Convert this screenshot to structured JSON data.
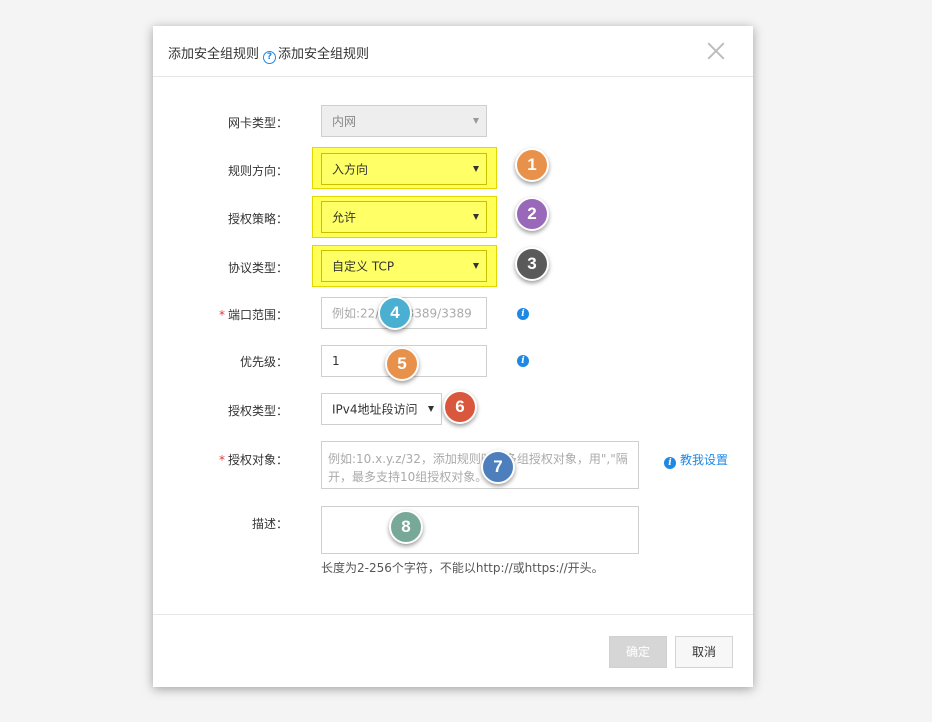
{
  "dialog": {
    "title": "添加安全组规则",
    "help_text": "添加安全组规则",
    "help_icon": "?"
  },
  "form": {
    "nic_type": {
      "label": "网卡类型：",
      "value": "内网"
    },
    "direction": {
      "label": "规则方向：",
      "value": "入方向"
    },
    "policy": {
      "label": "授权策略：",
      "value": "允许"
    },
    "protocol": {
      "label": "协议类型：",
      "value": "自定义 TCP"
    },
    "port_range": {
      "required": "*",
      "label": "端口范围：",
      "placeholder": "例如:22/22或3389/3389"
    },
    "priority": {
      "label": "优先级：",
      "value": "1"
    },
    "auth_type": {
      "label": "授权类型：",
      "value": "IPv4地址段访问"
    },
    "auth_object": {
      "required": "*",
      "label": "授权对象：",
      "placeholder": "例如:10.x.y.z/32，添加规则时可多组授权对象，用\",\"隔开，最多支持10组授权对象。",
      "help_link": "教我设置"
    },
    "description": {
      "label": "描述：",
      "value": "",
      "hint": "长度为2-256个字符，不能以http://或https://开头。"
    }
  },
  "icons": {
    "info": "i"
  },
  "badges": [
    {
      "n": "1",
      "color": "#e8914a"
    },
    {
      "n": "2",
      "color": "#9a68b8"
    },
    {
      "n": "3",
      "color": "#5a5a5a"
    },
    {
      "n": "4",
      "color": "#4aafd0"
    },
    {
      "n": "5",
      "color": "#e8914a"
    },
    {
      "n": "6",
      "color": "#d8573d"
    },
    {
      "n": "7",
      "color": "#4d7fbd"
    },
    {
      "n": "8",
      "color": "#77a898"
    }
  ],
  "footer": {
    "ok_label": "确定",
    "cancel_label": "取消"
  }
}
